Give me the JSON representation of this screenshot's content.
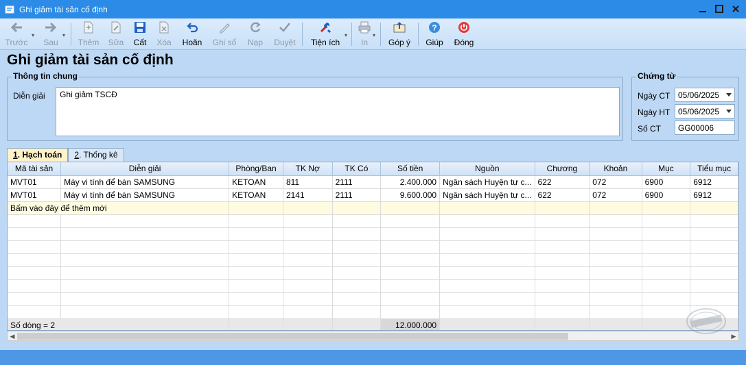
{
  "window": {
    "title": "Ghi giảm tài sản cố định",
    "colors": {
      "titlebar": "#2b8be6",
      "background": "#bcd8f5",
      "statusbar": "#4d97e4"
    }
  },
  "toolbar": {
    "prev": "Trước",
    "next": "Sau",
    "add": "Thêm",
    "edit": "Sửa",
    "save": "Cất",
    "delete": "Xóa",
    "undo": "Hoãn",
    "post": "Ghi sổ",
    "reload": "Nạp",
    "approve": "Duyệt",
    "utilities": "Tiện ích",
    "print": "In",
    "feedback": "Góp ý",
    "help": "Giúp",
    "close": "Đóng"
  },
  "page": {
    "title": "Ghi giảm tài sản cố định"
  },
  "general_info": {
    "legend": "Thông tin chung",
    "description_label": "Diễn giải",
    "description_value": "Ghi giảm TSCĐ"
  },
  "voucher": {
    "legend": "Chứng từ",
    "voucher_date_label": "Ngày CT",
    "voucher_date": "05/06/2025",
    "posting_date_label": "Ngày HT",
    "posting_date": "05/06/2025",
    "voucher_no_label": "Số CT",
    "voucher_no": "GG00006"
  },
  "tabs": [
    {
      "num": "1",
      "label": ". Hạch toán",
      "active": true
    },
    {
      "num": "2",
      "label": ". Thống kê",
      "active": false
    }
  ],
  "grid": {
    "columns": [
      "Mã tài sản",
      "Diễn giải",
      "Phòng/Ban",
      "TK Nợ",
      "TK Có",
      "Số tiền",
      "Nguồn",
      "Chương",
      "Khoản",
      "Mục",
      "Tiểu mục"
    ],
    "rows": [
      [
        "MVT01",
        "Máy vi tính để bàn SAMSUNG",
        "KETOAN",
        "811",
        "2111",
        "2.400.000",
        "Ngân sách Huyện tự c...",
        "622",
        "072",
        "6900",
        "6912"
      ],
      [
        "MVT01",
        "Máy vi tính để bàn SAMSUNG",
        "KETOAN",
        "2141",
        "2111",
        "9.600.000",
        "Ngân sách Huyện tự c...",
        "622",
        "072",
        "6900",
        "6912"
      ]
    ],
    "add_new_text": "Bấm vào đây để thêm mới",
    "row_count_text": "Số dòng = 2",
    "total_amount": "12.000.000"
  }
}
